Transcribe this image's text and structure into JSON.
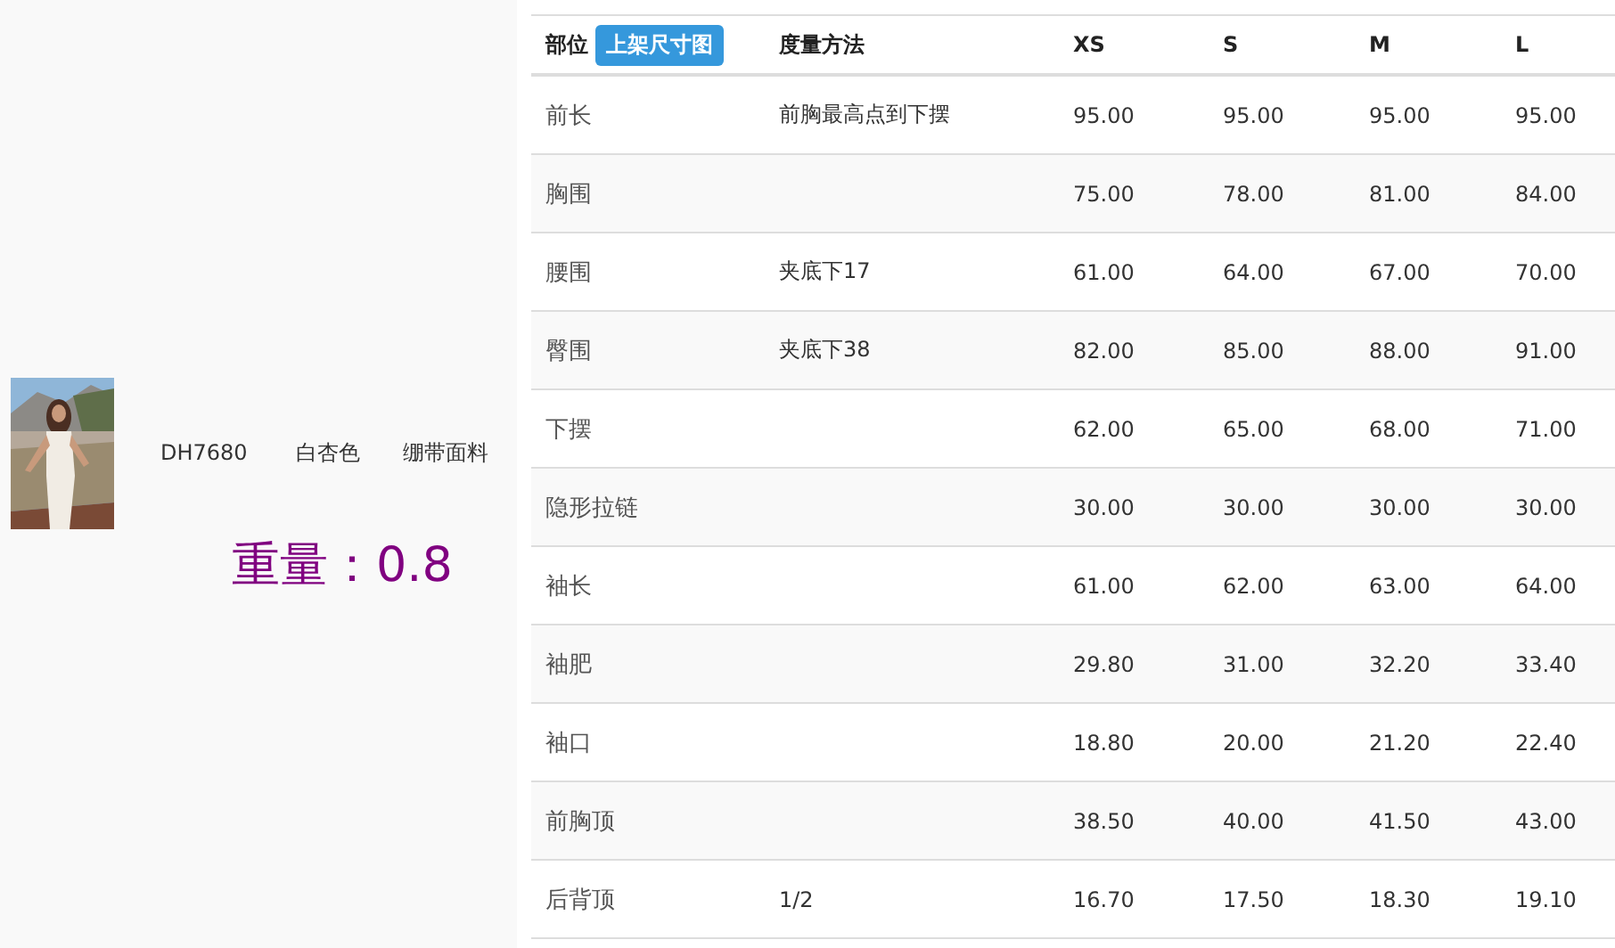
{
  "product": {
    "code": "DH7680",
    "color_name": "白杏色",
    "fabric": "绷带面料",
    "weight": "重量：0.8"
  },
  "table": {
    "columns": [
      {
        "label": "部位",
        "button": "上架尺寸图"
      },
      {
        "label": "度量方法"
      },
      {
        "label": "XS"
      },
      {
        "label": "S"
      },
      {
        "label": "M"
      },
      {
        "label": "L"
      }
    ],
    "rows": [
      [
        "前长",
        "前胸最高点到下摆",
        "95.00",
        "95.00",
        "95.00",
        "95.00"
      ],
      [
        "胸围",
        "",
        "75.00",
        "78.00",
        "81.00",
        "84.00"
      ],
      [
        "腰围",
        "夹底下17",
        "61.00",
        "64.00",
        "67.00",
        "70.00"
      ],
      [
        "臀围",
        "夹底下38",
        "82.00",
        "85.00",
        "88.00",
        "91.00"
      ],
      [
        "下摆",
        "",
        "62.00",
        "65.00",
        "68.00",
        "71.00"
      ],
      [
        "隐形拉链",
        "",
        "30.00",
        "30.00",
        "30.00",
        "30.00"
      ],
      [
        "袖长",
        "",
        "61.00",
        "62.00",
        "63.00",
        "64.00"
      ],
      [
        "袖肥",
        "",
        "29.80",
        "31.00",
        "32.20",
        "33.40"
      ],
      [
        "袖口",
        "",
        "18.80",
        "20.00",
        "21.20",
        "22.40"
      ],
      [
        "前胸顶",
        "",
        "38.50",
        "40.00",
        "41.50",
        "43.00"
      ],
      [
        "后背顶",
        "1/2",
        "16.70",
        "17.50",
        "18.30",
        "19.10"
      ]
    ]
  }
}
